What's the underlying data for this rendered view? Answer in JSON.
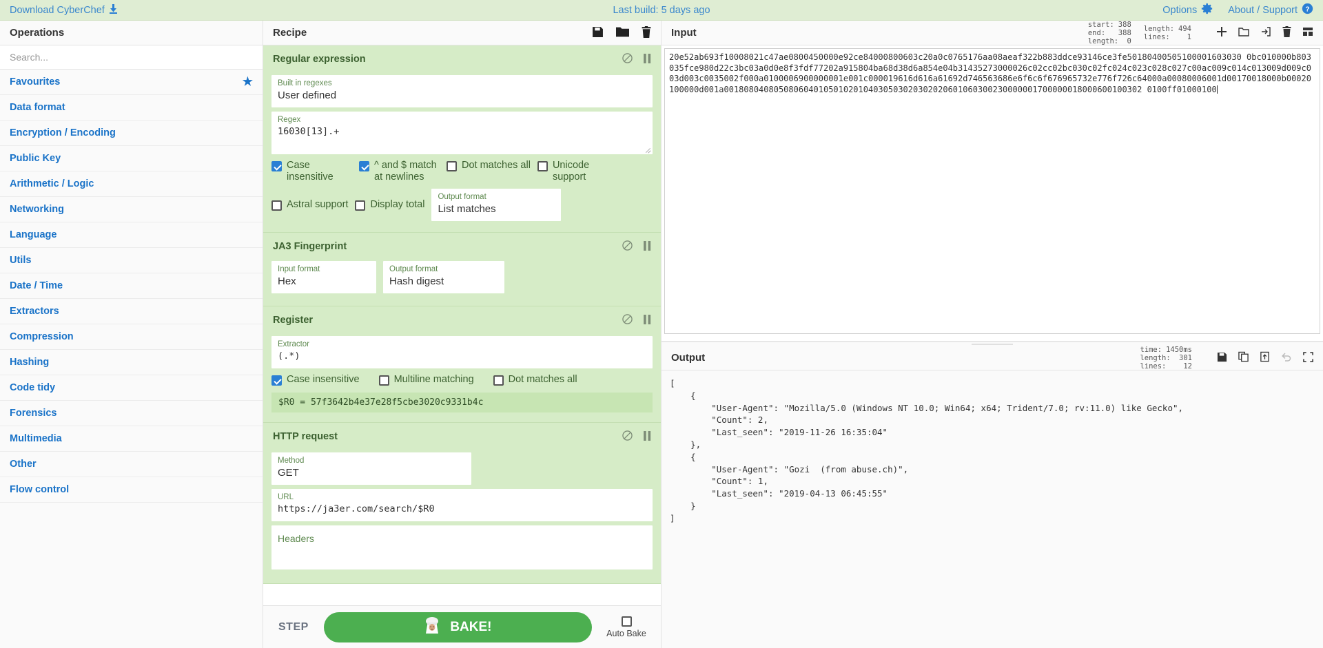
{
  "banner": {
    "download_label": "Download CyberChef",
    "download_icon": "download-icon",
    "last_build": "Last build: 5 days ago",
    "options_label": "Options",
    "options_icon": "gear-icon",
    "about_label": "About / Support",
    "about_icon": "question-circle-icon",
    "bg_color": "#dfedd3",
    "link_color": "#3a87cd"
  },
  "operations": {
    "title": "Operations",
    "search_placeholder": "Search...",
    "search_value": "",
    "categories": [
      {
        "label": "Favourites",
        "starred": true
      },
      {
        "label": "Data format",
        "starred": false
      },
      {
        "label": "Encryption / Encoding",
        "starred": false
      },
      {
        "label": "Public Key",
        "starred": false
      },
      {
        "label": "Arithmetic / Logic",
        "starred": false
      },
      {
        "label": "Networking",
        "starred": false
      },
      {
        "label": "Language",
        "starred": false
      },
      {
        "label": "Utils",
        "starred": false
      },
      {
        "label": "Date / Time",
        "starred": false
      },
      {
        "label": "Extractors",
        "starred": false
      },
      {
        "label": "Compression",
        "starred": false
      },
      {
        "label": "Hashing",
        "starred": false
      },
      {
        "label": "Code tidy",
        "starred": false
      },
      {
        "label": "Forensics",
        "starred": false
      },
      {
        "label": "Multimedia",
        "starred": false
      },
      {
        "label": "Other",
        "starred": false
      },
      {
        "label": "Flow control",
        "starred": false
      }
    ]
  },
  "recipe": {
    "title": "Recipe",
    "icons": [
      "save-icon",
      "folder-icon",
      "trash-icon"
    ],
    "op1": {
      "name": "Regular expression",
      "builtin_label": "Built in regexes",
      "builtin_value": "User defined",
      "regex_label": "Regex",
      "regex_value": "16030[13].+",
      "chk_case_label": "Case insensitive",
      "chk_case_checked": true,
      "chk_anchors_label": "^ and $ match at newlines",
      "chk_anchors_checked": true,
      "chk_dotall_label": "Dot matches all",
      "chk_dotall_checked": false,
      "chk_unicode_label": "Unicode support",
      "chk_unicode_checked": false,
      "chk_astral_label": "Astral support",
      "chk_astral_checked": false,
      "chk_total_label": "Display total",
      "chk_total_checked": false,
      "outfmt_label": "Output format",
      "outfmt_value": "List matches"
    },
    "op2": {
      "name": "JA3 Fingerprint",
      "input_label": "Input format",
      "input_value": "Hex",
      "output_label": "Output format",
      "output_value": "Hash digest"
    },
    "op3": {
      "name": "Register",
      "extractor_label": "Extractor",
      "extractor_value": "(.*)",
      "chk_case_label": "Case insensitive",
      "chk_case_checked": true,
      "chk_multiline_label": "Multiline matching",
      "chk_multiline_checked": false,
      "chk_dotall_label": "Dot matches all",
      "chk_dotall_checked": false,
      "register_note": "$R0 = 57f3642b4e37e28f5cbe3020c9331b4c"
    },
    "op4": {
      "name": "HTTP request",
      "method_label": "Method",
      "method_value": "GET",
      "url_label": "URL",
      "url_value": "https://ja3er.com/search/$R0",
      "headers_label": "Headers",
      "headers_value": ""
    },
    "step_label": "STEP",
    "bake_label": "BAKE!",
    "bake_icon": "chef-icon",
    "bake_color": "#4caf50",
    "autobake_label": "Auto Bake",
    "autobake_checked": false
  },
  "input": {
    "title": "Input",
    "stats_left": [
      {
        "key": "start:",
        "value": "388"
      },
      {
        "key": "end:",
        "value": "388"
      },
      {
        "key": "length:",
        "value": "0"
      }
    ],
    "stats_right": [
      {
        "key": "length:",
        "value": "494"
      },
      {
        "key": "lines:",
        "value": "1"
      }
    ],
    "icons": [
      "plus-icon",
      "folder-open-icon",
      "import-icon",
      "trash-icon",
      "tabs-icon"
    ],
    "text": "20e52ab693f10008021c47ae0800450000e92ce84000800603c20a0c0765176aa08aeaf322b883ddce93146ce3fe50180400505100001603030 0bc010000b803035fce980d22c3bc03a0d0e8f3fdf77202a915804ba68d38d6a854e04b31435273000026c02cc02bc030c02fc024c023c028c027c00ac009c014c013009d009c003d003c0035002f000a0100006900000001e001c000019616d616a61692d746563686e6f6c6f676965732e776f726c64000a00080006001d00170018000b00020100000d001a001808040805080604010501020104030503020302020601060300230000001700000018000600100302 0100ff01000100"
  },
  "output": {
    "title": "Output",
    "stats": [
      {
        "key": "time:",
        "value": "1450ms"
      },
      {
        "key": "length:",
        "value": "301"
      },
      {
        "key": "lines:",
        "value": "12"
      }
    ],
    "icons": [
      "save-icon",
      "copy-icon",
      "move-to-input-icon",
      "undo-icon",
      "maximise-icon"
    ],
    "text": "[\n    {\n        \"User-Agent\": \"Mozilla/5.0 (Windows NT 10.0; Win64; x64; Trident/7.0; rv:11.0) like Gecko\",\n        \"Count\": 2,\n        \"Last_seen\": \"2019-11-26 16:35:04\"\n    },\n    {\n        \"User-Agent\": \"Gozi  (from abuse.ch)\",\n        \"Count\": 1,\n        \"Last_seen\": \"2019-04-13 06:45:55\"\n    }\n]"
  }
}
